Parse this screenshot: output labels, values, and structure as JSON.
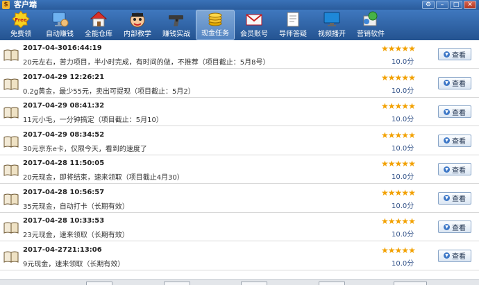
{
  "window": {
    "title": "客户端"
  },
  "toolbar": {
    "items": [
      {
        "label": "免费领",
        "icon": "free-badge-icon"
      },
      {
        "label": "自动赚钱",
        "icon": "monitor-hand-icon"
      },
      {
        "label": "全能仓库",
        "icon": "house-icon"
      },
      {
        "label": "内部教学",
        "icon": "teacher-face-icon"
      },
      {
        "label": "赚钱实战",
        "icon": "pistol-icon"
      },
      {
        "label": "现金任务",
        "icon": "coin-stack-icon"
      },
      {
        "label": "会员账号",
        "icon": "envelope-icon"
      },
      {
        "label": "导师答疑",
        "icon": "document-icon"
      },
      {
        "label": "视频播开",
        "icon": "monitor-icon"
      },
      {
        "label": "营销软件",
        "icon": "software-box-icon"
      }
    ],
    "active_index": 5
  },
  "tasks": [
    {
      "date": "2017-04-3016:44:19",
      "desc": "20元左右，苦力项目，半小时完成，有时间的做，不推荐（项目截止：5月8号）",
      "rating": 5,
      "score": "10.0分",
      "action": "查看"
    },
    {
      "date": "2017-04-29 12:26:21",
      "desc": "0.2g黄金，最少55元，卖出可提现（项目截止：5月2）",
      "rating": 5,
      "score": "10.0分",
      "action": "查看"
    },
    {
      "date": "2017-04-29 08:41:32",
      "desc": "11元小毛，一分钟搞定（项目截止：5月10）",
      "rating": 5,
      "score": "10.0分",
      "action": "查看"
    },
    {
      "date": "2017-04-29 08:34:52",
      "desc": "30元京东e卡，仅限今天，看到的速度了",
      "rating": 5,
      "score": "10.0分",
      "action": "查看"
    },
    {
      "date": "2017-04-28 11:50:05",
      "desc": "20元现金，即将结束，速来领取（项目截止4月30）",
      "rating": 5,
      "score": "10.0分",
      "action": "查看"
    },
    {
      "date": "2017-04-28 10:56:57",
      "desc": "35元现金，自动打卡（长期有效）",
      "rating": 5,
      "score": "10.0分",
      "action": "查看"
    },
    {
      "date": "2017-04-28 10:33:53",
      "desc": "23元现金，速来领取（长期有效）",
      "rating": 5,
      "score": "10.0分",
      "action": "查看"
    },
    {
      "date": "2017-04-2721:13:06",
      "desc": "9元现金，速来领取（长期有效）",
      "rating": 5,
      "score": "10.0分",
      "action": "查看"
    }
  ],
  "colors": {
    "star": "#f2a100",
    "score": "#2f4f86",
    "chrome": "#2b5a93"
  }
}
